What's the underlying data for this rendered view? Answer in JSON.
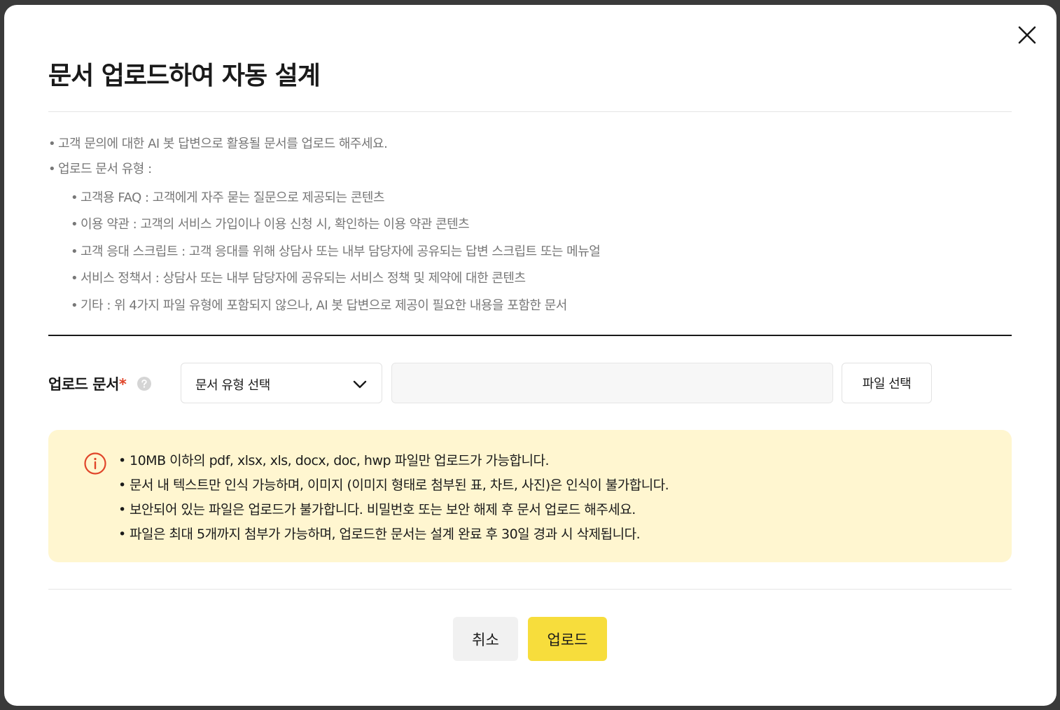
{
  "modal": {
    "title": "문서 업로드하여 자동 설계"
  },
  "guide": {
    "bullet": "•",
    "intro": "고객 문의에 대한 AI 봇 답변으로 활용될 문서를 업로드 해주세요.",
    "types_heading": "업로드 문서 유형 :",
    "types": [
      "고객용 FAQ : 고객에게 자주 묻는 질문으로 제공되는 콘텐츠",
      "이용 약관 : 고객의 서비스 가입이나 이용 신청 시, 확인하는 이용 약관 콘텐츠",
      "고객 응대 스크립트 : 고객 응대를 위해 상담사 또는 내부 담당자에 공유되는 답변 스크립트 또는 메뉴얼",
      "서비스 정책서 : 상담사 또는 내부 담당자에 공유되는 서비스 정책 및 제약에 대한 콘텐츠",
      "기타 : 위 4가지 파일 유형에 포함되지 않으나, AI 봇 답변으로 제공이 필요한 내용을 포함한 문서"
    ]
  },
  "form": {
    "label": "업로드 문서",
    "required_mark": "*",
    "type_select_value": "문서 유형 선택",
    "file_field_value": "",
    "file_button_label": "파일 선택"
  },
  "notice": {
    "bullet": "•",
    "lines": [
      "10MB 이하의 pdf, xlsx, xls, docx, doc, hwp 파일만 업로드가 가능합니다.",
      "문서 내 텍스트만 인식 가능하며, 이미지 (이미지 형태로 첨부된 표, 차트, 사진)은 인식이 불가합니다.",
      "보안되어 있는 파일은 업로드가 불가합니다. 비밀번호 또는 보안 해제 후 문서 업로드 해주세요.",
      "파일은 최대 5개까지 첨부가 가능하며, 업로드한 문서는 설계 완료 후 30일 경과 시 삭제됩니다."
    ]
  },
  "actions": {
    "cancel_label": "취소",
    "upload_label": "업로드"
  },
  "colors": {
    "accent_yellow": "#f7dd3c",
    "notice_bg": "#fff6d0",
    "required_red": "#e0452a",
    "info_icon_red": "#e0452a"
  },
  "icons": {
    "close": "close-icon",
    "help": "question-circle-icon",
    "dropdown": "chevron-down-icon",
    "info": "info-circle-icon"
  }
}
